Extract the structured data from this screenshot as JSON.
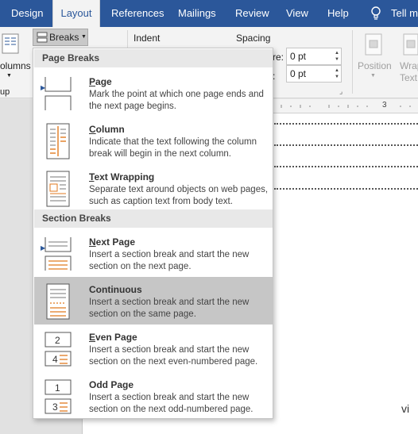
{
  "tabs": [
    {
      "label": "Design",
      "active": false
    },
    {
      "label": "Layout",
      "active": true
    },
    {
      "label": "References",
      "active": false
    },
    {
      "label": "Mailings",
      "active": false
    },
    {
      "label": "Review",
      "active": false
    },
    {
      "label": "View",
      "active": false
    },
    {
      "label": "Help",
      "active": false
    }
  ],
  "tell_me": "Tell m",
  "ribbon": {
    "columns_label": "olumns",
    "group_label": "up",
    "breaks_label": "Breaks",
    "indent_label": "Indent",
    "spacing_label": "Spacing",
    "before_label": "re:",
    "before_value": "0 pt",
    "after_label": ":",
    "after_value": "0 pt",
    "position_label": "Position",
    "wrap_label_1": "Wrap",
    "wrap_label_2": "Text"
  },
  "page_text": "vi",
  "menu": {
    "page_breaks_header": "Page Breaks",
    "section_breaks_header": "Section Breaks",
    "items": [
      {
        "key": "P",
        "rest": "age",
        "desc": "Mark the point at which one page ends and the next page begins.",
        "icon": "page-break-icon"
      },
      {
        "key": "C",
        "rest": "olumn",
        "desc": "Indicate that the text following the column break will begin in the next column.",
        "icon": "column-break-icon"
      },
      {
        "key": "T",
        "rest": "ext Wrapping",
        "desc": "Separate text around objects on web pages, such as caption text from body text.",
        "icon": "text-wrapping-icon"
      },
      {
        "key": "N",
        "rest": "ext Page",
        "desc": "Insert a section break and start the new section on the next page.",
        "icon": "next-page-icon"
      },
      {
        "key": "",
        "rest": "Continuous",
        "desc": "Insert a section break and start the new section on the same page.",
        "icon": "continuous-icon"
      },
      {
        "key": "E",
        "rest": "ven Page",
        "desc": "Insert a section break and start the new section on the next even-numbered page.",
        "icon": "even-page-icon"
      },
      {
        "key": "",
        "rest": "Odd Page",
        "desc": "Insert a section break and start the new section on the next odd-numbered page.",
        "icon": "odd-page-icon"
      }
    ]
  },
  "colors": {
    "accent": "#2b579a",
    "highlight": "#c6c6c6"
  }
}
